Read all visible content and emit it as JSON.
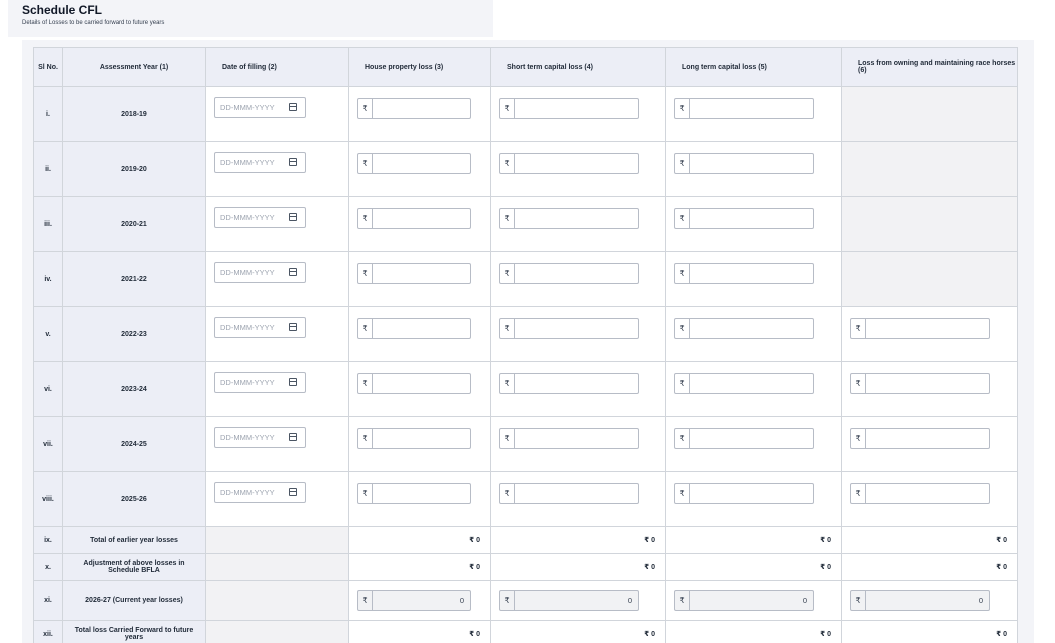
{
  "schedule": {
    "title": "Schedule CFL",
    "subtitle": "Details of Losses to be carried forward to future years"
  },
  "table": {
    "headers": [
      "Sl No.",
      "Assessment Year (1)",
      "Date of filling (2)",
      "House property loss (3)",
      "Short term capital loss (4)",
      "Long term capital loss (5)",
      "Loss from owning and maintaining race horses (6)"
    ],
    "currency_symbol": "₹",
    "date_placeholder": "DD-MMM-YYYY",
    "rows": [
      {
        "sl": "i.",
        "ay": "2018-19",
        "race_horse": false
      },
      {
        "sl": "ii.",
        "ay": "2019-20",
        "race_horse": false
      },
      {
        "sl": "iii.",
        "ay": "2020-21",
        "race_horse": false
      },
      {
        "sl": "iv.",
        "ay": "2021-22",
        "race_horse": false
      },
      {
        "sl": "v.",
        "ay": "2022-23",
        "race_horse": true
      },
      {
        "sl": "vi.",
        "ay": "2023-24",
        "race_horse": true
      },
      {
        "sl": "vii.",
        "ay": "2024-25",
        "race_horse": true
      },
      {
        "sl": "viii.",
        "ay": "2025-26",
        "race_horse": true
      }
    ],
    "total_earlier": {
      "sl": "ix.",
      "label": "Total of earlier year losses",
      "values": [
        "₹ 0",
        "₹ 0",
        "₹ 0",
        "₹ 0"
      ]
    },
    "adjustment": {
      "sl": "x.",
      "label": "Adjustment of above losses in Schedule BFLA",
      "values": [
        "₹ 0",
        "₹ 0",
        "₹ 0",
        "₹ 0"
      ]
    },
    "current_year": {
      "sl": "xi.",
      "label": "2026-27 (Current year losses)",
      "values": [
        "0",
        "0",
        "0",
        "0"
      ]
    },
    "carried_forward": {
      "sl": "xii.",
      "label": "Total loss Carried Forward to future years",
      "values": [
        "₹ 0",
        "₹ 0",
        "₹ 0",
        "₹ 0"
      ]
    }
  }
}
